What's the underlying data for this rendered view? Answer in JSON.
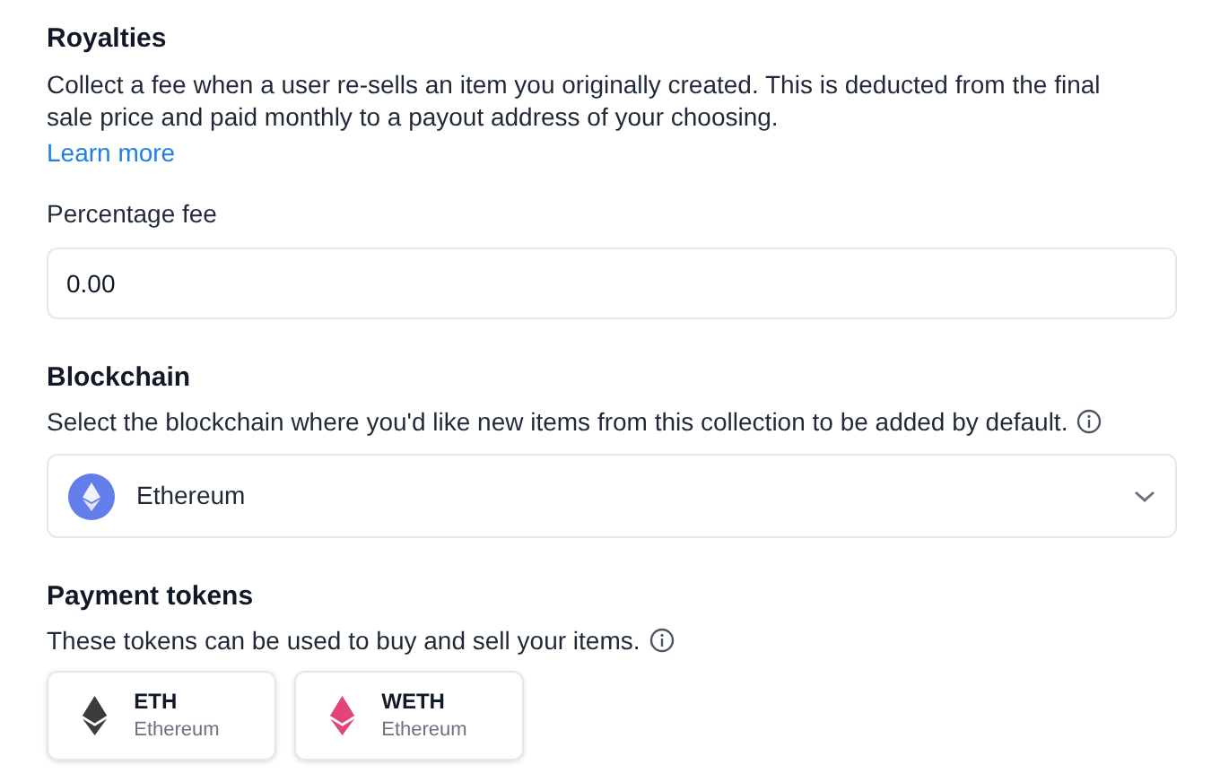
{
  "royalties": {
    "title": "Royalties",
    "description": "Collect a fee when a user re-sells an item you originally created. This is deducted from the final sale price and paid monthly to a payout address of your choosing.",
    "link": "Learn more",
    "field_label": "Percentage fee",
    "field_value": "0.00"
  },
  "blockchain": {
    "title": "Blockchain",
    "description": "Select the blockchain where you'd like new items from this collection to be added by default.",
    "selected_value": "Ethereum"
  },
  "payment_tokens": {
    "title": "Payment tokens",
    "description": "These tokens can be used to buy and sell your items.",
    "tokens": [
      {
        "symbol": "ETH",
        "network": "Ethereum",
        "color": "#3c3c3d"
      },
      {
        "symbol": "WETH",
        "network": "Ethereum",
        "color": "#e2457a"
      }
    ]
  }
}
